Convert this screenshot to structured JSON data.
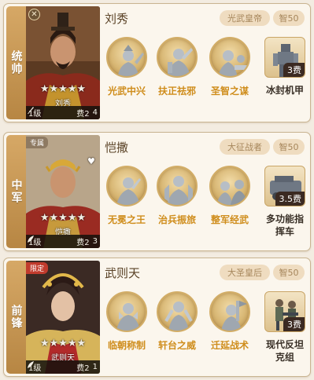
{
  "colors": {
    "card_bg": "#fbf6ed",
    "card_border": "#c9b491",
    "role_strip": "#c9964f",
    "skill_label": "#cf8d1c",
    "badge_bg": "#efdcc0",
    "badge_text": "#a6865b",
    "limited_tag": "#c13b2d",
    "exclusive_tag": "#8e7a62"
  },
  "cards": [
    {
      "role": "统帅",
      "portrait_tag": "",
      "hero_name": "刘秀",
      "portrait_caption": "刘秀",
      "stars": "★★★★★",
      "level": "1级",
      "cost": "费2",
      "count": "4",
      "title_badge": "光武皇帝",
      "power_badge": "智50",
      "skills": [
        "光武中兴",
        "扶正祛邪",
        "圣智之谋"
      ],
      "gear": {
        "cost": "3费",
        "label_line1": "冰封机甲",
        "label_line2": ""
      }
    },
    {
      "role": "中军",
      "portrait_tag": "专属",
      "hero_name": "恺撒",
      "portrait_caption": "恺撒",
      "stars": "★★★★★",
      "level": "1级",
      "cost": "费2",
      "count": "3",
      "title_badge": "大征战者",
      "power_badge": "智50",
      "skills": [
        "无冕之王",
        "治兵振旅",
        "整军经武"
      ],
      "gear": {
        "cost": "3.5费",
        "label_line1": "多功能指",
        "label_line2": "挥车"
      }
    },
    {
      "role": "前锋",
      "portrait_tag": "限定",
      "hero_name": "武则天",
      "portrait_caption": "武则天",
      "stars": "★★★★★",
      "level": "1级",
      "cost": "费2",
      "count": "1",
      "title_badge": "大圣皇后",
      "power_badge": "智50",
      "skills": [
        "临朝称制",
        "轩台之威",
        "迁延战术"
      ],
      "gear": {
        "cost": "3费",
        "label_line1": "现代反坦",
        "label_line2": "克组"
      }
    }
  ]
}
